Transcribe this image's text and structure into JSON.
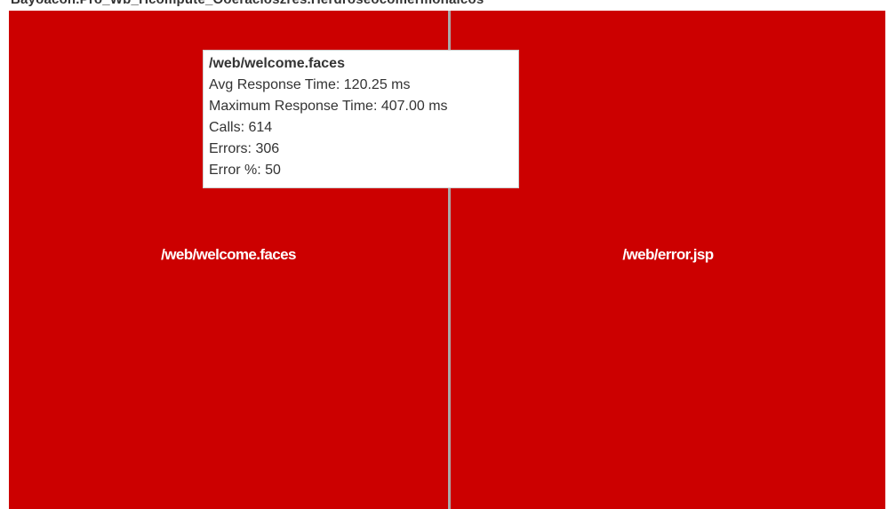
{
  "header": {
    "text": "Bayoacon.Pro_Wb_Hcompute_Ooeracioszres.Herdroseocomermonaicos"
  },
  "treemap": {
    "color": "#cc0000",
    "tiles": [
      {
        "label": "/web/welcome.faces"
      },
      {
        "label": "/web/error.jsp"
      }
    ]
  },
  "tooltip": {
    "title": "/web/welcome.faces",
    "avg_response": "Avg Response Time: 120.25 ms",
    "max_response": "Maximum Response Time: 407.00 ms",
    "calls": "Calls: 614",
    "errors": "Errors: 306",
    "error_pct": "Error %: 50"
  }
}
